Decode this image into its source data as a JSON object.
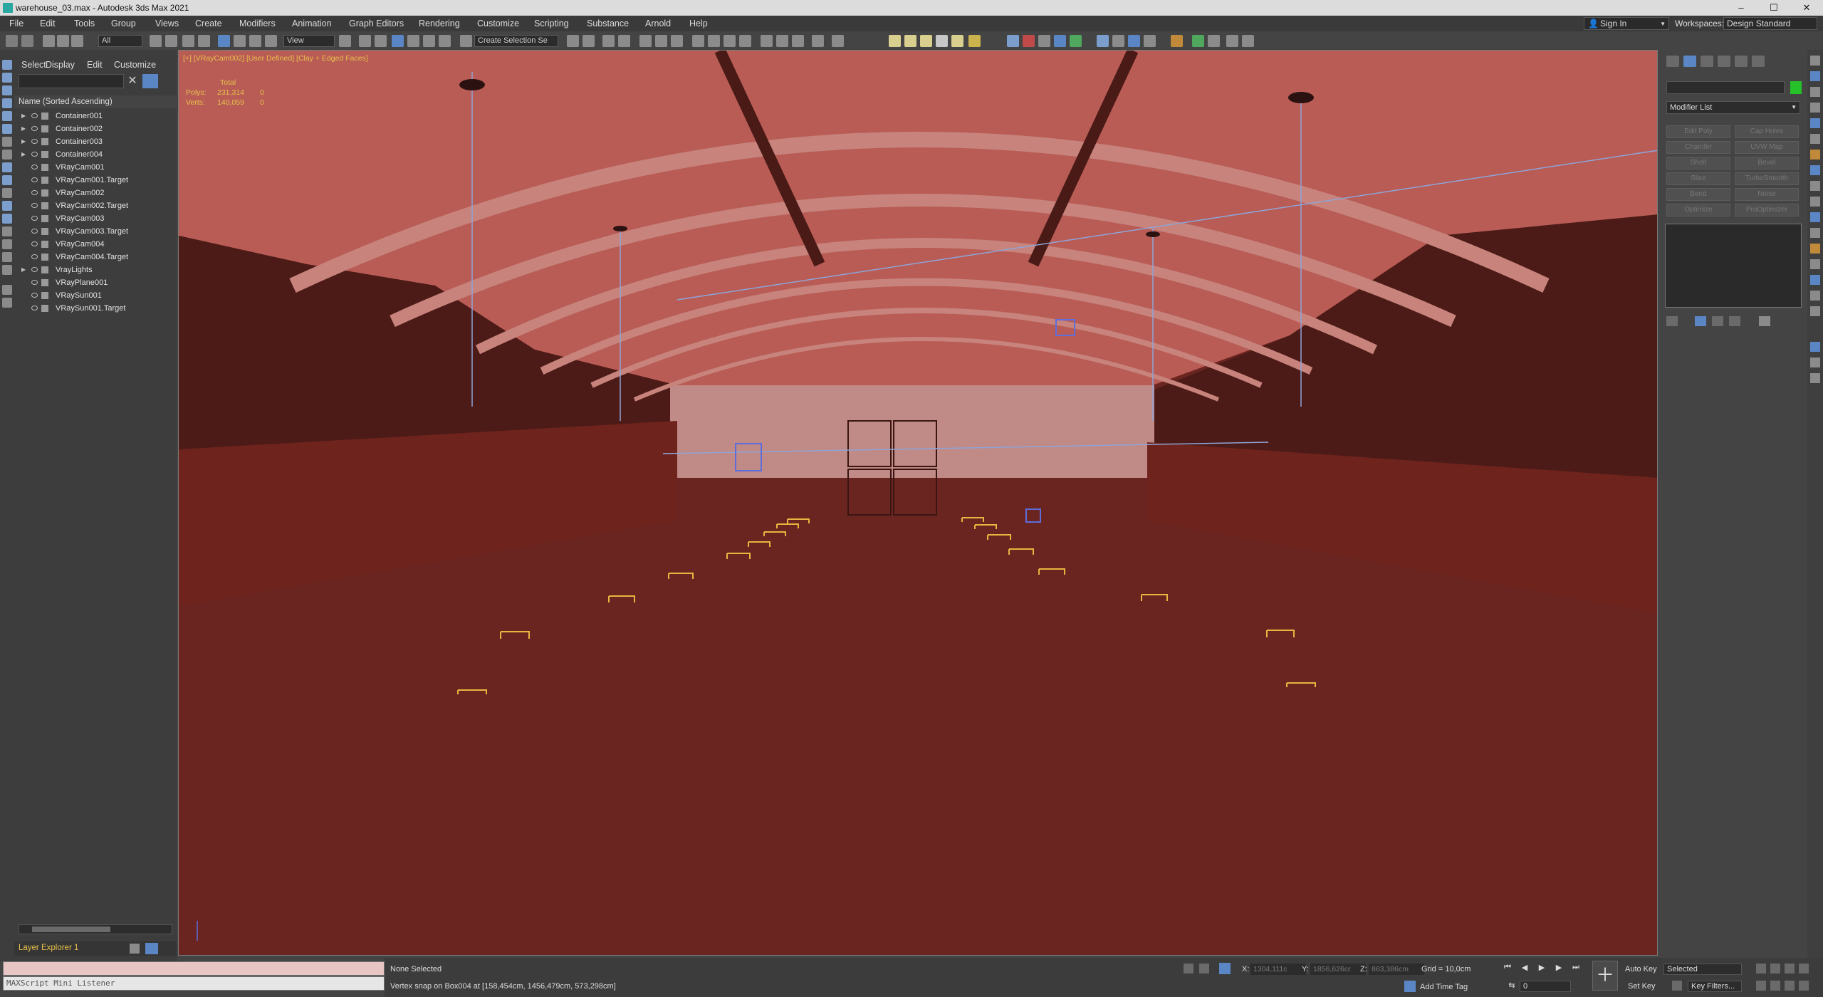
{
  "window": {
    "title": "warehouse_03.max - Autodesk 3ds Max 2021",
    "minimize": "–",
    "maximize": "☐",
    "close": "✕"
  },
  "menu": [
    "File",
    "Edit",
    "Tools",
    "Group",
    "Views",
    "Create",
    "Modifiers",
    "Animation",
    "Graph Editors",
    "Rendering",
    "Customize",
    "Scripting",
    "Substance",
    "Arnold",
    "Help"
  ],
  "account": {
    "sign_in": "Sign In",
    "workspaces_label": "Workspaces:",
    "workspace": "Design Standard"
  },
  "toolbar": {
    "selection_filter": "All",
    "ref_coord": "View",
    "named_selection": "Create Selection Se"
  },
  "scene_explorer": {
    "tabs": [
      "Select",
      "Display",
      "Edit",
      "Customize"
    ],
    "column_header": "Name (Sorted Ascending)",
    "items": [
      {
        "name": "Container001",
        "expandable": true
      },
      {
        "name": "Container002",
        "expandable": true
      },
      {
        "name": "Container003",
        "expandable": true
      },
      {
        "name": "Container004",
        "expandable": true
      },
      {
        "name": "VRayCam001",
        "expandable": false
      },
      {
        "name": "VRayCam001.Target",
        "expandable": false
      },
      {
        "name": "VRayCam002",
        "expandable": false
      },
      {
        "name": "VRayCam002.Target",
        "expandable": false
      },
      {
        "name": "VRayCam003",
        "expandable": false
      },
      {
        "name": "VRayCam003.Target",
        "expandable": false
      },
      {
        "name": "VRayCam004",
        "expandable": false
      },
      {
        "name": "VRayCam004.Target",
        "expandable": false
      },
      {
        "name": "VrayLights",
        "expandable": true
      },
      {
        "name": "VRayPlane001",
        "expandable": false
      },
      {
        "name": "VRaySun001",
        "expandable": false
      },
      {
        "name": "VRaySun001.Target",
        "expandable": false
      }
    ],
    "layer_explorer": "Layer Explorer 1"
  },
  "viewport": {
    "label": "[+] [VRayCam002] [User Defined] [Clay + Edged Faces]",
    "stats": {
      "total_label": "Total",
      "polys_label": "Polys:",
      "polys": "231,314",
      "polys_sel": "0",
      "verts_label": "Verts:",
      "verts": "140,059",
      "verts_sel": "0"
    }
  },
  "command_panel": {
    "modifier_list": "Modifier List",
    "modifier_buttons": [
      "Edit Poly",
      "Cap Holes",
      "Chamfer",
      "UVW Map",
      "Shell",
      "Bevel",
      "Slice",
      "TurboSmooth",
      "Bend",
      "Noise",
      "Optimize",
      "ProOptimizer"
    ]
  },
  "maxscript": {
    "listener": "MAXScript Mini Listener"
  },
  "status": {
    "selection": "None Selected",
    "prompt": "Vertex snap on Box004 at [158,454cm, 1456,479cm, 573,298cm]",
    "x_label": "X:",
    "x": "1304,111c",
    "y_label": "Y:",
    "y": "1856,626cr",
    "z_label": "Z:",
    "z": "863,386cm",
    "grid": "Grid = 10,0cm",
    "add_time_tag": "Add Time Tag",
    "auto_key": "Auto Key",
    "set_key": "Set Key",
    "key_mode": "Selected",
    "key_filters": "Key Filters...",
    "frame": "0"
  },
  "colors": {
    "viewport_bg": "#6b2520",
    "highlight": "#e8c14a",
    "active_blue": "#5b86c6"
  }
}
